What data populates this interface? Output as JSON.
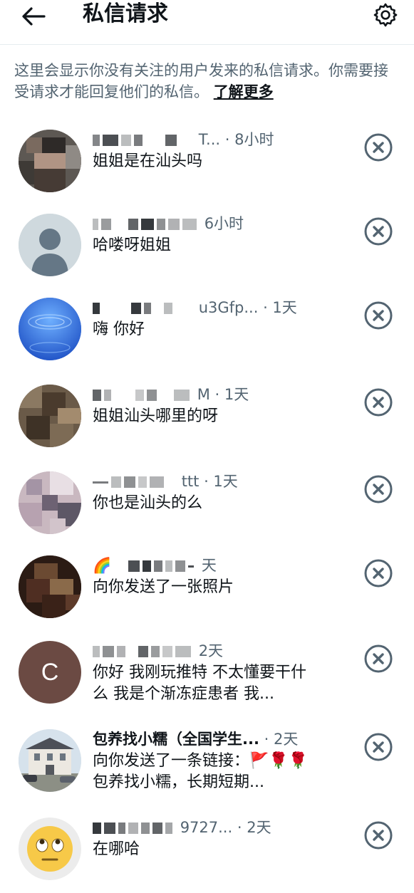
{
  "header": {
    "title": "私信请求"
  },
  "intro": {
    "text": "这里会显示你没有关注的用户发来的私信请求。你需要接受请求才能回复他们的私信。",
    "learn_more": "了解更多"
  },
  "requests": [
    {
      "handle_fragment": "T...",
      "time": "· 8小时",
      "message": "姐姐是在汕头吗",
      "avatar": "pixelated-photo"
    },
    {
      "handle_fragment": "",
      "time": "6小时",
      "message": "哈喽呀姐姐",
      "avatar": "default-person"
    },
    {
      "handle_fragment": "u3Gfp...",
      "time": "· 1天",
      "message": "嗨 你好",
      "avatar": "blue-planet"
    },
    {
      "handle_fragment": "M",
      "time": "· 1天",
      "message": "姐姐汕头哪里的呀",
      "avatar": "pixelated-photo"
    },
    {
      "handle_fragment": "ttt",
      "time": "· 1天",
      "message": "你也是汕头的么",
      "avatar": "pixelated-photo"
    },
    {
      "handle_fragment": "🌈",
      "time": "天",
      "message": "向你发送了一张照片",
      "avatar": "pixelated-photo"
    },
    {
      "handle_fragment": "",
      "time": "2天",
      "message": "你好 我刚玩推特 不太懂要干什么 我是个渐冻症患者 我...",
      "avatar_letter": "C"
    },
    {
      "name": "包养找小糯（全国学生...",
      "time": "· 2天",
      "message": "向你发送了一条链接：🚩🌹🌹 包养找小糯，长期短期...",
      "avatar": "building-photo"
    },
    {
      "handle_fragment": "9727...",
      "time": "· 2天",
      "message": "在哪哈",
      "avatar": "eye-roll-emoji"
    }
  ],
  "icons": {
    "back": "arrow-left-icon",
    "settings": "gear-icon",
    "dismiss": "close-circle-icon"
  },
  "colors": {
    "text_primary": "#0f1419",
    "text_secondary": "#536471",
    "icon": "#536471",
    "avatar_c_bg": "#6b4a43"
  }
}
